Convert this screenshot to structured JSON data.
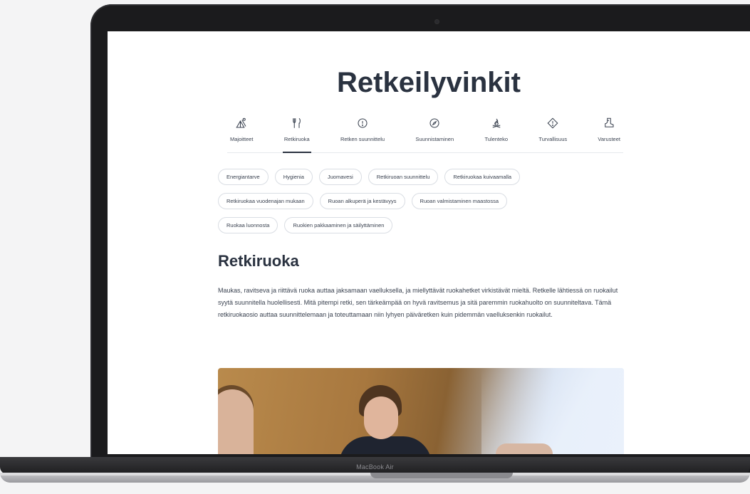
{
  "page": {
    "title": "Retkeilyvinkit"
  },
  "nav": {
    "items": [
      {
        "label": "Majoitteet",
        "icon": "tent-icon"
      },
      {
        "label": "Retkiruoka",
        "icon": "fork-knife-icon",
        "active": true
      },
      {
        "label": "Retken suunnittelu",
        "icon": "info-icon"
      },
      {
        "label": "Suunnistaminen",
        "icon": "compass-icon"
      },
      {
        "label": "Tulenteko",
        "icon": "campfire-icon"
      },
      {
        "label": "Turvallisuus",
        "icon": "warning-sign-icon"
      },
      {
        "label": "Varusteet",
        "icon": "boot-icon"
      }
    ]
  },
  "chips": {
    "row1": [
      "Energiantarve",
      "Hygienia",
      "Juomavesi",
      "Retkiruoan suunnittelu",
      "Retkiruokaa kuivaamalla"
    ],
    "row2": [
      "Retkiruokaa vuodenajan mukaan",
      "Ruoan alkuperä ja kestävyys",
      "Ruoan valmistaminen maastossa"
    ],
    "row3": [
      "Ruokaa luonnosta",
      "Ruokien pakkaaminen ja säilyttäminen"
    ]
  },
  "section": {
    "title": "Retkiruoka",
    "body": "Maukas, ravitseva ja riittävä ruoka auttaa jaksamaan vaelluksella, ja miellyttävät ruokahetket virkistävät mieltä. Retkelle lähtiessä on ruokailut syytä suunnitella huolellisesti. Mitä pitempi retki, sen tärkeämpää on hyvä ravitsemus ja sitä paremmin ruokahuolto on suunniteltava. Tämä retkiruokaosio auttaa suunnittelemaan ja toteuttamaan niin lyhyen päiväretken kuin pidemmän vaelluksenkin ruokailut."
  },
  "device": {
    "label": "MacBook Air"
  },
  "colors": {
    "heading": "#2a3240",
    "text": "#3a4250",
    "chip_border": "#d9dde3",
    "bezel": "#1b1b1d"
  }
}
